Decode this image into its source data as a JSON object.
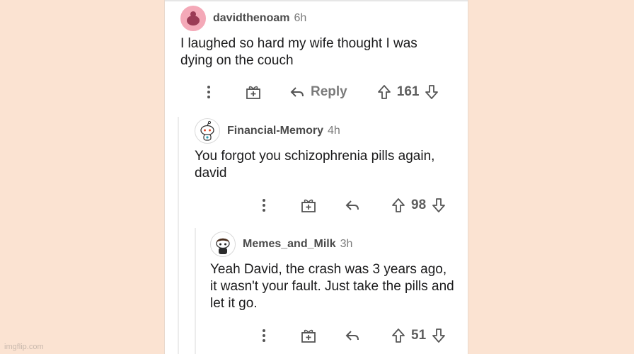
{
  "comments": [
    {
      "username": "davidthenoam",
      "time": "6h",
      "text": "I laughed so hard my wife thought I was dying on the couch",
      "reply_label": "Reply",
      "votes": "161"
    },
    {
      "username": "Financial-Memory",
      "time": "4h",
      "text": "You forgot you schizophrenia pills again, david",
      "votes": "98"
    },
    {
      "username": "Memes_and_Milk",
      "time": "3h",
      "text": "Yeah David, the crash was 3 years ago, it wasn't your fault. Just take the pills and let it go.",
      "votes": "51"
    }
  ],
  "watermark": "imgflip.com",
  "colors": {
    "background": "#fbe3d2",
    "card": "#ffffff",
    "text": "#1a1a1b",
    "muted": "#7a7a7a"
  }
}
